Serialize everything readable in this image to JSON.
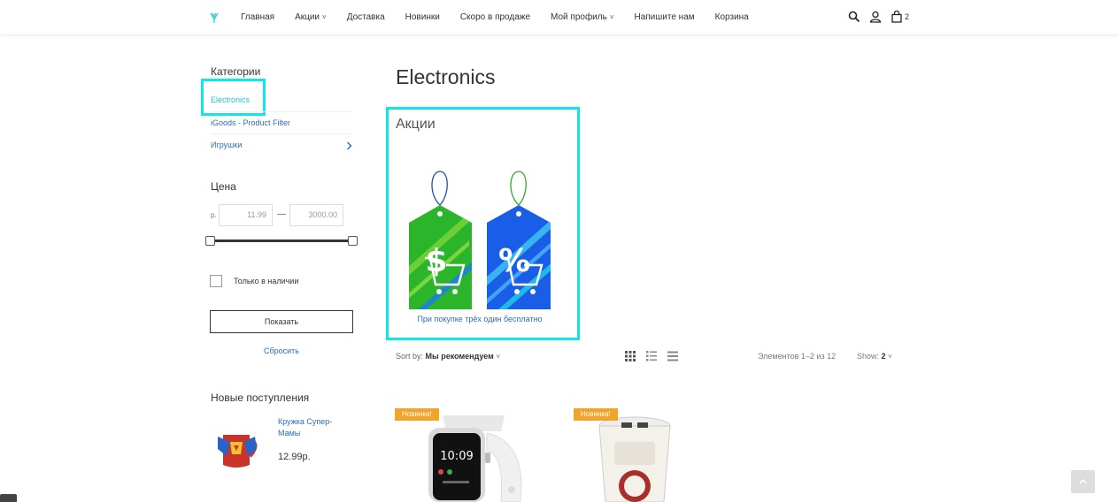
{
  "header": {
    "nav": [
      {
        "label": "Главная",
        "dropdown": false
      },
      {
        "label": "Акции",
        "dropdown": true
      },
      {
        "label": "Доставка",
        "dropdown": false
      },
      {
        "label": "Новинки",
        "dropdown": false
      },
      {
        "label": "Скоро в продаже",
        "dropdown": false
      },
      {
        "label": "Мой профиль",
        "dropdown": true
      },
      {
        "label": "Напишите нам",
        "dropdown": false
      },
      {
        "label": "Корзина",
        "dropdown": false
      }
    ],
    "cart_count": "2"
  },
  "sidebar": {
    "categories_title": "Категории",
    "categories": [
      "Electronics",
      "iGoods - Product Filter",
      "Игрушки"
    ],
    "price_title": "Цена",
    "currency": "р.",
    "price_min": "11.99",
    "price_max": "3000.00",
    "price_dash": "—",
    "in_stock_label": "Только в наличии",
    "show_button": "Показать",
    "reset_link": "Сбросить",
    "new_title": "Новые поступления",
    "new_product": {
      "name": "Кружка Супер-Мамы",
      "price": "12.99р."
    }
  },
  "main": {
    "title": "Electronics",
    "promo": {
      "title": "Акции",
      "caption": "При покупке трёх один бесплатно",
      "tag_symbols": [
        "$",
        "%"
      ]
    },
    "toolbar": {
      "sort_prefix": "Sort by:",
      "sort_value": "Мы рекомендуем",
      "count": "Элементов 1–2 из 12",
      "show_prefix": "Show:",
      "show_value": "2"
    },
    "products": [
      {
        "badge": "Новинка!"
      },
      {
        "badge": "Новинка!"
      }
    ]
  },
  "colors": {
    "accent": "#1fc4d3",
    "link": "#2a6ebb",
    "highlight": "#10e4ec",
    "badge": "#f0a42a",
    "tag_green": "#2bb52b",
    "tag_blue": "#1a5ee8"
  }
}
